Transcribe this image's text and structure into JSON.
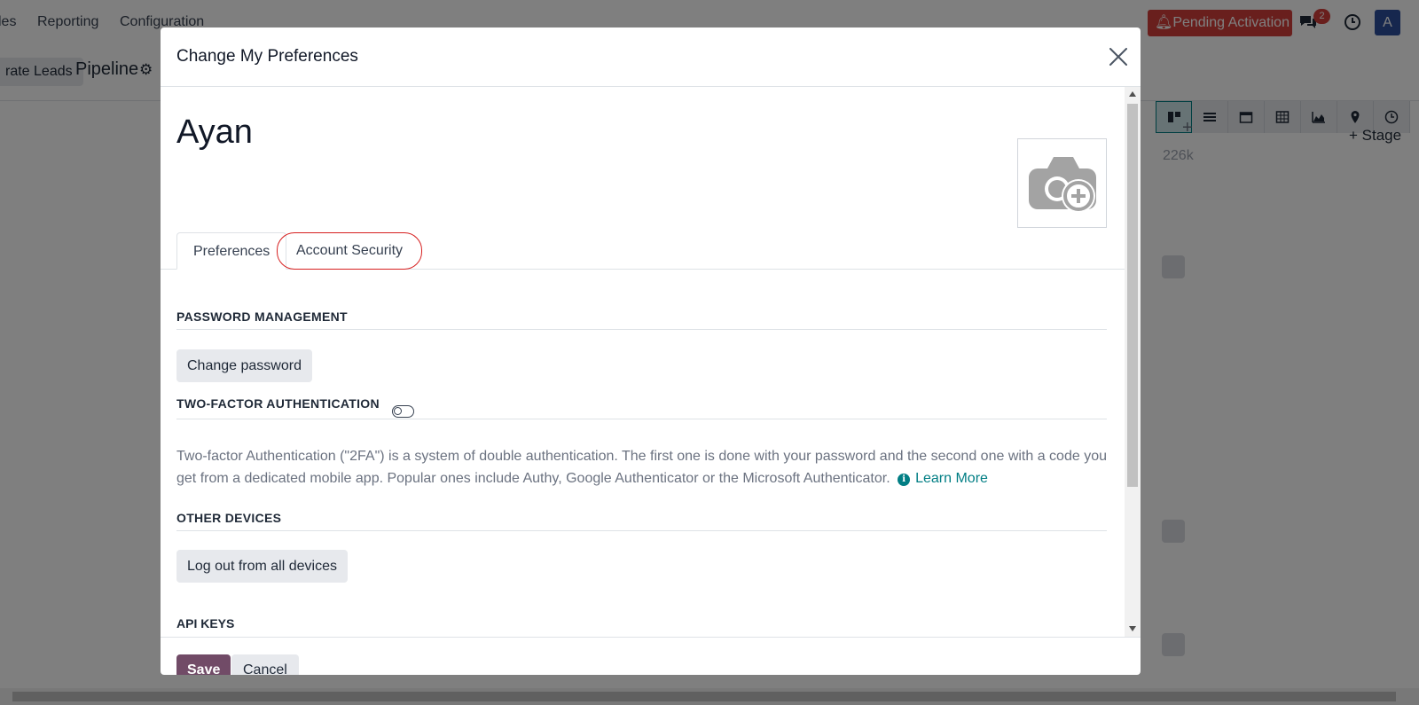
{
  "app": {
    "menu": [
      "les",
      "Reporting",
      "Configuration"
    ],
    "generate_leads_label": "rate Leads",
    "breadcrumb_title": "Pipeline",
    "pending_activation_label": "Pending Activation",
    "chat_badge_count": "2",
    "avatar_letter": "A",
    "kanban_column_total": "226k",
    "add_stage_label": "Stage"
  },
  "modal": {
    "title": "Change My Preferences",
    "user_name": "Ayan",
    "tabs": [
      {
        "label": "Preferences"
      },
      {
        "label": "Account Security"
      }
    ],
    "sections": {
      "password_management": {
        "heading": "PASSWORD MANAGEMENT",
        "button_label": "Change password"
      },
      "two_factor": {
        "heading": "TWO-FACTOR AUTHENTICATION",
        "enabled": false,
        "description": "Two-factor Authentication (\"2FA\") is a system of double authentication. The first one is done with your password and the second one with a code you get from a dedicated mobile app. Popular ones include Authy, Google Authenticator or the Microsoft Authenticator.",
        "learn_more_label": "Learn More"
      },
      "other_devices": {
        "heading": "OTHER DEVICES",
        "button_label": "Log out from all devices"
      },
      "api_keys": {
        "heading": "API KEYS"
      }
    },
    "footer": {
      "save_label": "Save",
      "cancel_label": "Cancel"
    }
  },
  "colors": {
    "brand_primary": "#714b67",
    "accent_teal": "#017e84",
    "alert_red": "#d23f3a",
    "avatar_blue": "#2c4e9c"
  }
}
